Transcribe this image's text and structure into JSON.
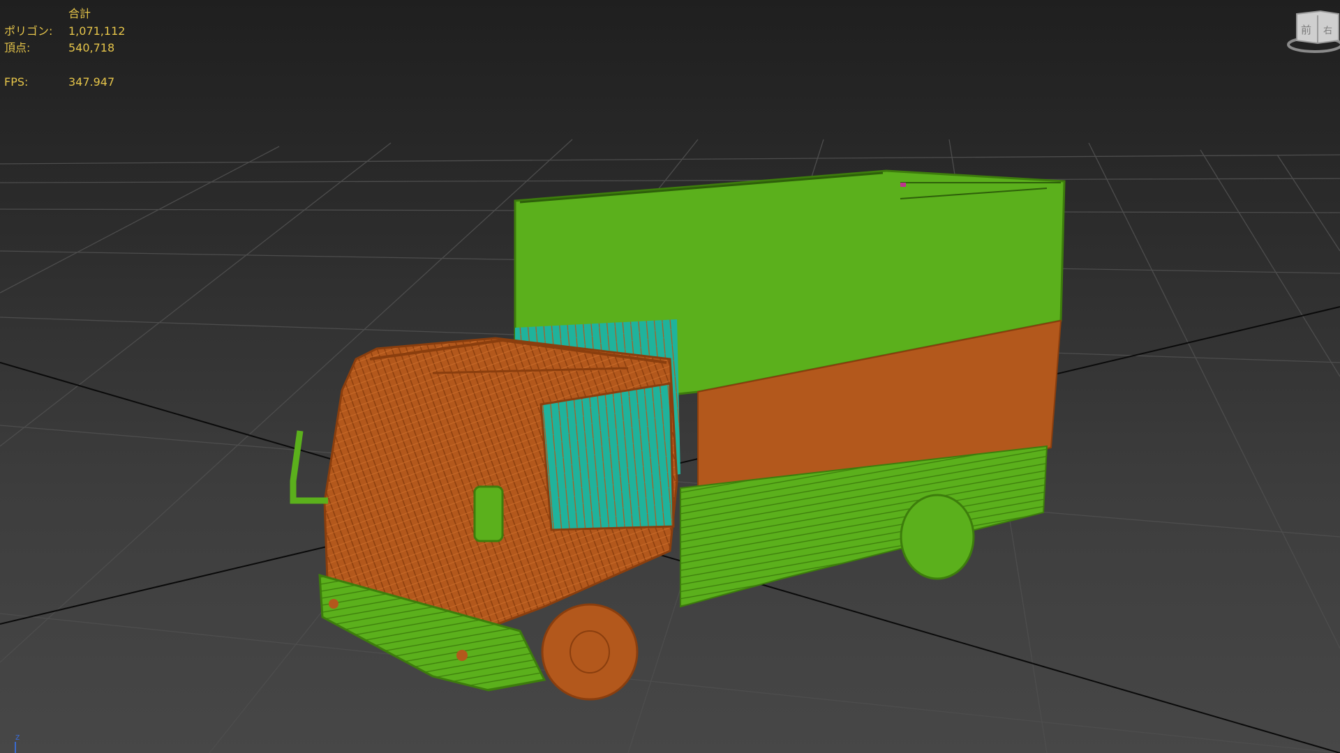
{
  "stats": {
    "header": "合計",
    "polygons_label": "ポリゴン:",
    "polygons_value": "1,071,112",
    "vertices_label": "頂点:",
    "vertices_value": "540,718",
    "fps_label": "FPS:",
    "fps_value": "347.947"
  },
  "viewcube": {
    "face_label": "前",
    "side_label": "右"
  },
  "axis": {
    "label": "z"
  },
  "colors": {
    "stats_text": "#e6c54a",
    "body_green": "#5bb01c",
    "cab_orange": "#b3581c",
    "glass_teal": "#1fb39c",
    "grid_line": "#4d4d4d",
    "axis_line": "#0a0a0a",
    "axis_z": "#3a6ad0"
  },
  "scene": {
    "object": "box truck wireframe model"
  }
}
